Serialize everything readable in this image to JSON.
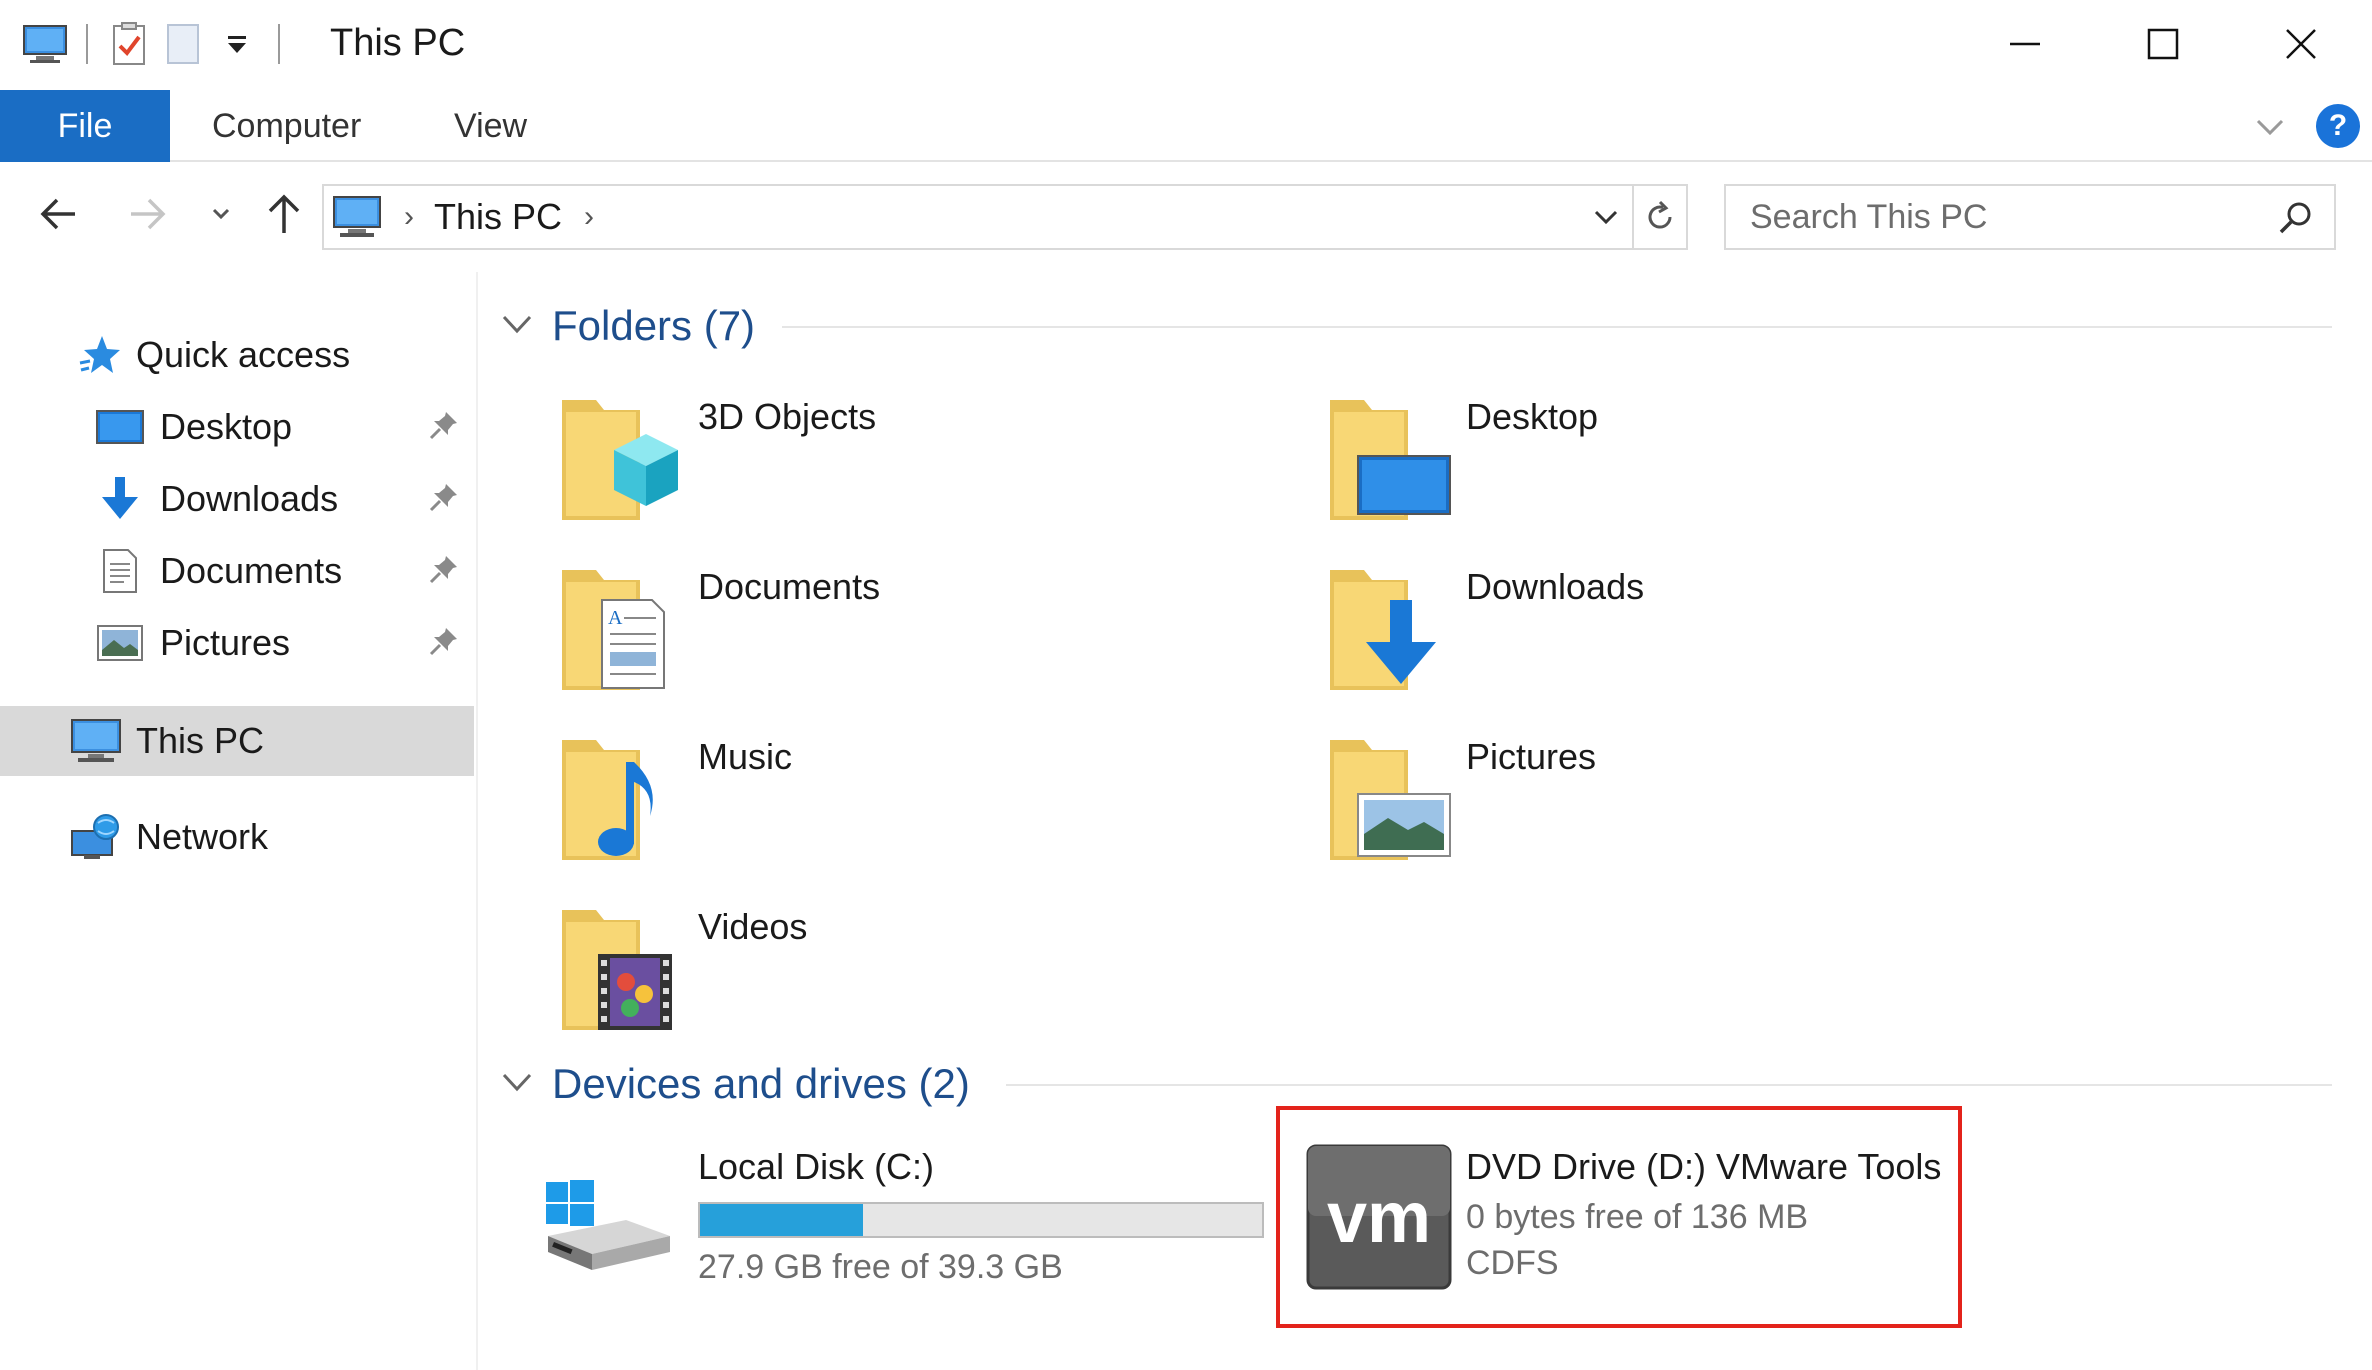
{
  "window": {
    "title": "This PC"
  },
  "ribbon": {
    "tabs": [
      {
        "label": "File",
        "active": true
      },
      {
        "label": "Computer"
      },
      {
        "label": "View"
      }
    ],
    "help_label": "?"
  },
  "navigation": {
    "breadcrumb": [
      "This PC"
    ],
    "search_placeholder": "Search This PC"
  },
  "sidebar": {
    "quick_access": {
      "label": "Quick access",
      "icon": "star-icon"
    },
    "quick_items": [
      {
        "label": "Desktop",
        "icon": "desktop-icon",
        "pinned": true
      },
      {
        "label": "Downloads",
        "icon": "download-arrow-icon",
        "pinned": true
      },
      {
        "label": "Documents",
        "icon": "document-icon",
        "pinned": true
      },
      {
        "label": "Pictures",
        "icon": "picture-icon",
        "pinned": true
      }
    ],
    "this_pc": {
      "label": "This PC",
      "icon": "computer-icon",
      "selected": true
    },
    "network": {
      "label": "Network",
      "icon": "network-icon"
    }
  },
  "folders": {
    "header": "Folders (7)",
    "items": [
      {
        "label": "3D Objects",
        "icon": "3d-objects-folder-icon"
      },
      {
        "label": "Desktop",
        "icon": "desktop-folder-icon"
      },
      {
        "label": "Documents",
        "icon": "documents-folder-icon"
      },
      {
        "label": "Downloads",
        "icon": "downloads-folder-icon"
      },
      {
        "label": "Music",
        "icon": "music-folder-icon"
      },
      {
        "label": "Pictures",
        "icon": "pictures-folder-icon"
      },
      {
        "label": "Videos",
        "icon": "videos-folder-icon"
      }
    ]
  },
  "devices": {
    "header": "Devices and drives (2)",
    "local_disk": {
      "label": "Local Disk (C:)",
      "free_text": "27.9 GB free of 39.3 GB",
      "used_fraction": 0.29,
      "icon": "windows-drive-icon"
    },
    "dvd_drive": {
      "label": "DVD Drive (D:) VMware Tools",
      "free_text": "0 bytes free of 136 MB",
      "filesystem": "CDFS",
      "icon": "vmware-logo-icon",
      "logo_text": "vm"
    }
  },
  "colors": {
    "accent": "#1a6dc4",
    "group_header": "#1e4e8c",
    "drive_fill": "#26a0da",
    "highlight": "#e3231b",
    "folder_yellow": "#f8d775"
  }
}
